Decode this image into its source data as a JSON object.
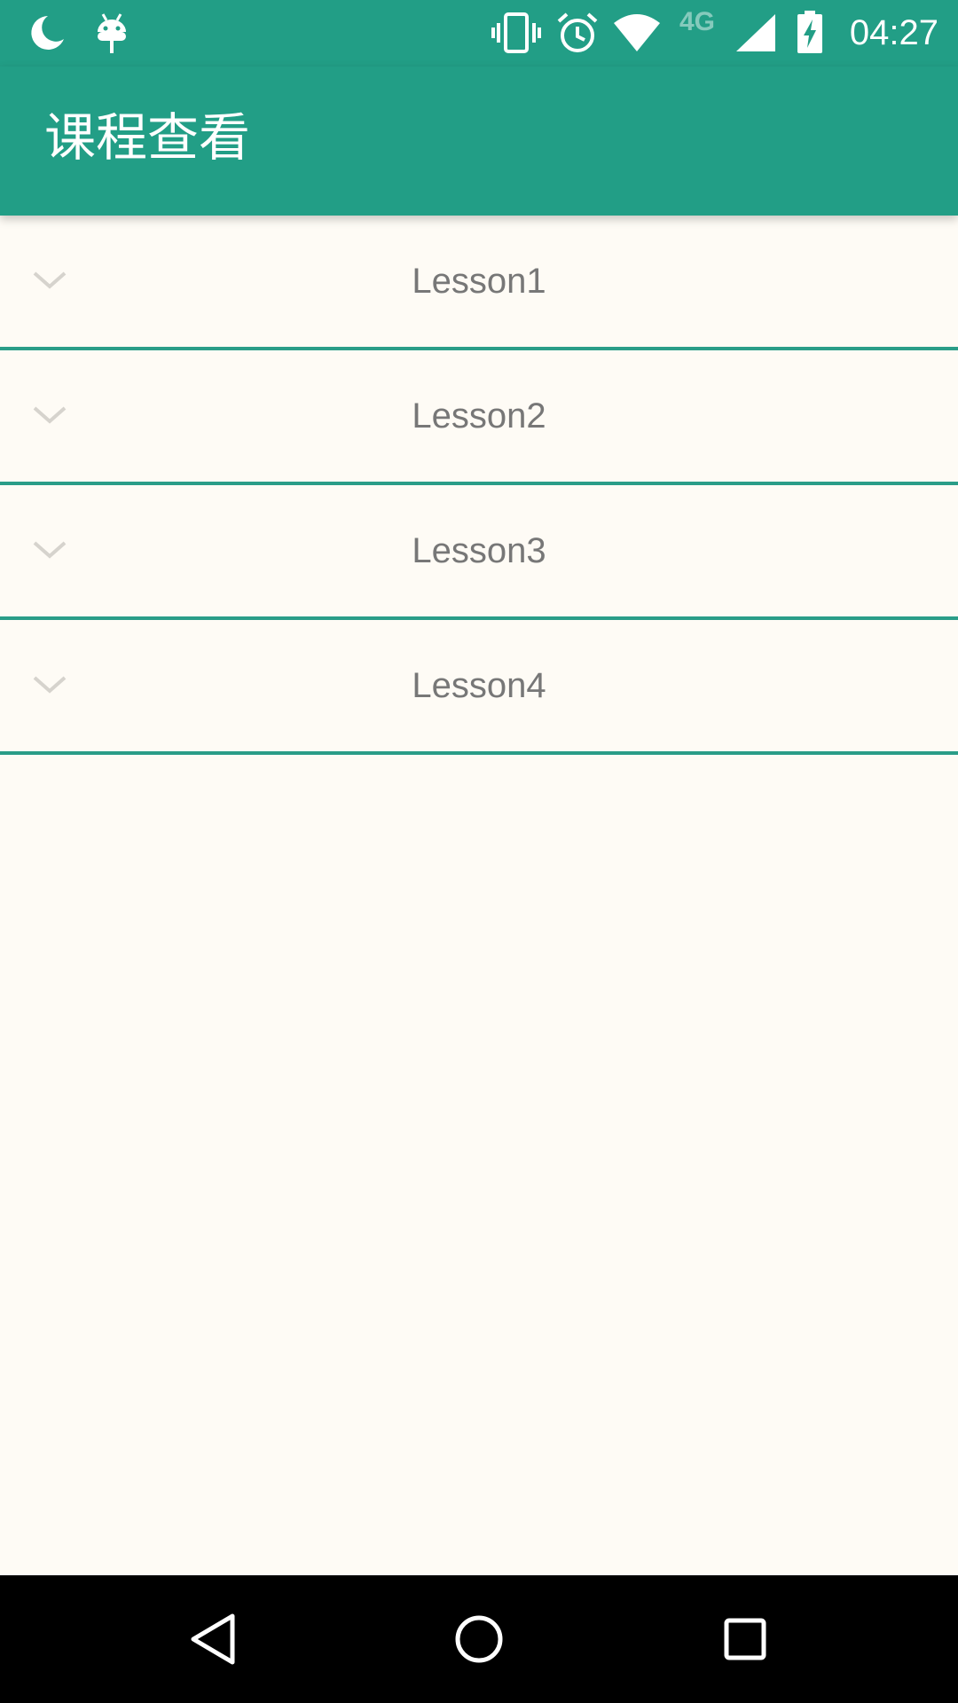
{
  "status_bar": {
    "time": "04:27",
    "network_label": "4G",
    "left_icons": [
      "moon-icon",
      "android-debug-icon"
    ],
    "right_icons": [
      "vibrate-icon",
      "alarm-icon",
      "wifi-icon",
      "signal-icon",
      "battery-charging-icon"
    ]
  },
  "app_bar": {
    "title": "课程查看"
  },
  "lessons": [
    {
      "label": "Lesson1"
    },
    {
      "label": "Lesson2"
    },
    {
      "label": "Lesson3"
    },
    {
      "label": "Lesson4"
    }
  ],
  "nav_bar": {
    "buttons": [
      "back-icon",
      "home-icon",
      "recents-icon"
    ]
  },
  "colors": {
    "primary": "#229E86",
    "divider": "#2A9D88",
    "background": "#FEFBF5",
    "lesson_text": "#777777",
    "chevron": "#D6D3CD"
  }
}
